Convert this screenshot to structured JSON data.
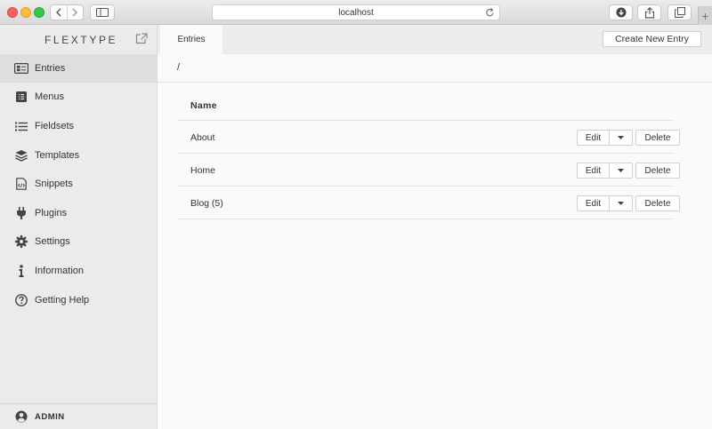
{
  "browser": {
    "url": "localhost",
    "icons": {
      "back": "chevron-left-icon",
      "forward": "chevron-right-icon",
      "sidebar": "sidebar-toggle-icon",
      "reload": "reload-icon",
      "download": "download-icon",
      "share": "share-icon",
      "tabs": "tabs-icon",
      "new_tab": "plus-icon"
    },
    "new_tab_label": "+"
  },
  "sidebar": {
    "brand": "FLEXTYPE",
    "brand_icon": "external-link-icon",
    "items": [
      {
        "label": "Entries",
        "icon": "entries-icon",
        "active": true
      },
      {
        "label": "Menus",
        "icon": "menus-icon",
        "active": false
      },
      {
        "label": "Fieldsets",
        "icon": "fieldsets-icon",
        "active": false
      },
      {
        "label": "Templates",
        "icon": "templates-icon",
        "active": false
      },
      {
        "label": "Snippets",
        "icon": "snippets-icon",
        "active": false
      },
      {
        "label": "Plugins",
        "icon": "plugins-icon",
        "active": false
      },
      {
        "label": "Settings",
        "icon": "settings-icon",
        "active": false
      },
      {
        "label": "Information",
        "icon": "information-icon",
        "active": false
      },
      {
        "label": "Getting Help",
        "icon": "help-icon",
        "active": false
      }
    ],
    "footer": {
      "label": "ADMIN",
      "icon": "user-icon"
    }
  },
  "main": {
    "tab": "Entries",
    "create_button": "Create New Entry",
    "breadcrumb": "/",
    "table": {
      "header": "Name",
      "rows": [
        {
          "name": "About",
          "edit": "Edit",
          "delete": "Delete"
        },
        {
          "name": "Home",
          "edit": "Edit",
          "delete": "Delete"
        },
        {
          "name": "Blog (5)",
          "edit": "Edit",
          "delete": "Delete"
        }
      ]
    }
  },
  "colors": {
    "chrome_bg": "#dcdcdc",
    "sidebar_bg": "#ebebeb",
    "active_item_bg": "#dedede",
    "content_bg": "#fafafa",
    "traffic_red": "#fc605c",
    "traffic_yellow": "#fdbc40",
    "traffic_green": "#34c84a"
  }
}
